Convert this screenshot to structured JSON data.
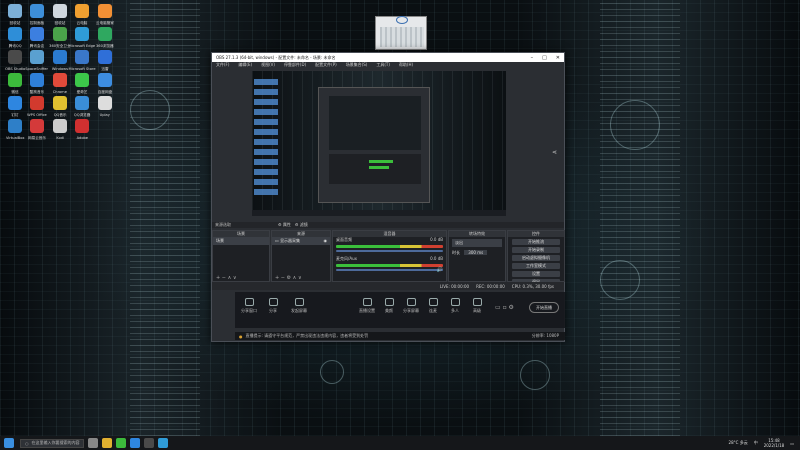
{
  "desktop": {
    "icons_left": [
      {
        "label": "回收站",
        "color": "#7cb0d8"
      },
      {
        "label": "控制面板",
        "color": "#3d8fd9"
      },
      {
        "label": "回收站",
        "color": "#cfd7de"
      },
      {
        "label": "云电脑",
        "color": "#f0a030"
      },
      {
        "label": "云电脑管家",
        "color": "#f29035"
      },
      {
        "label": "腾讯QQ",
        "color": "#2e8ed8"
      },
      {
        "label": "腾讯会议",
        "color": "#3c7fe0"
      },
      {
        "label": "360安全卫士",
        "color": "#4aa34a"
      },
      {
        "label": "Microsoft Edge",
        "color": "#2f9cd8"
      },
      {
        "label": "360浏览器",
        "color": "#2fa860"
      },
      {
        "label": "OBS Studio",
        "color": "#4a4a4a"
      },
      {
        "label": "SpaceSniffer",
        "color": "#5aa0d0"
      },
      {
        "label": "Windows",
        "color": "#2b7bd0"
      },
      {
        "label": "Microsoft Store",
        "color": "#3a77c8"
      },
      {
        "label": "迅雷",
        "color": "#2f6fd8"
      },
      {
        "label": "微信",
        "color": "#3cba3c"
      },
      {
        "label": "酷狗音乐",
        "color": "#2e7fd8"
      },
      {
        "label": "Chrome",
        "color": "#e04a3a"
      },
      {
        "label": "爱奇艺",
        "color": "#3cc84a"
      },
      {
        "label": "百度网盘",
        "color": "#3d8de0"
      },
      {
        "label": "钉钉",
        "color": "#2e86e0"
      },
      {
        "label": "WPS Office",
        "color": "#d23a2e"
      },
      {
        "label": "QQ音乐",
        "color": "#e0c030"
      },
      {
        "label": "QQ浏览器",
        "color": "#3a8ed8"
      },
      {
        "label": "Uplay",
        "color": "#dddddd"
      },
      {
        "label": "VirtualBox",
        "color": "#2e7fc8"
      },
      {
        "label": "网易云音乐",
        "color": "#d43a3a"
      },
      {
        "label": "Kodi",
        "color": "#cccccc"
      },
      {
        "label": "Adobe",
        "color": "#d03030"
      }
    ]
  },
  "obs": {
    "title": "OBS 27.1.3 (64-bit, windows) - 配置文件: 未命名 - 场景: 未命名",
    "menu": [
      "文件(F)",
      "编辑(E)",
      "视图(V)",
      "停靠部件(D)",
      "配置文件(P)",
      "场景集合(S)",
      "工具(T)",
      "帮助(H)"
    ],
    "dock_header": "来源选取",
    "scene_bar": [
      "⚙ 属性",
      "⚙ 滤镜"
    ],
    "docks": {
      "scenes": {
        "title": "场景",
        "items": [
          "场景"
        ]
      },
      "sources": {
        "title": "来源",
        "items": [
          "显示器采集"
        ]
      },
      "mixer": {
        "title": "混音器",
        "channels": [
          {
            "name": "桌面音频",
            "db": "0.0 dB"
          },
          {
            "name": "麦克风/Aux",
            "db": "0.0 dB"
          }
        ]
      },
      "transitions": {
        "title": "转场特效",
        "type": "淡出",
        "duration_label": "时长",
        "duration": "300 ms"
      },
      "controls": {
        "title": "控件",
        "buttons": [
          "开始推流",
          "开始录制",
          "启动虚拟摄像机",
          "工作室模式",
          "设置",
          "退出"
        ]
      }
    },
    "status": [
      "LIVE: 00:00:00",
      "REC: 00:00:00",
      "CPU: 0.3%, 30.00 fps"
    ]
  },
  "live_strip": {
    "left_tools": [
      "分享窗口",
      "分享",
      "发起屏幕"
    ],
    "tools": [
      "直播设置",
      "美颜",
      "分享屏幕",
      "连麦",
      "多人",
      "高级"
    ],
    "go_live": "开始直播",
    "notice": "直播提示: 请遵守平台规范，严禁出现违法违规内容，违者将受到处罚",
    "notice_right": "分辨率: 1080P"
  },
  "taskbar": {
    "search_placeholder": "在这里输入你要搜索的内容",
    "tray_items": [
      "28°C 多云",
      "中"
    ],
    "time": "15:48",
    "date": "2022/1/18"
  }
}
